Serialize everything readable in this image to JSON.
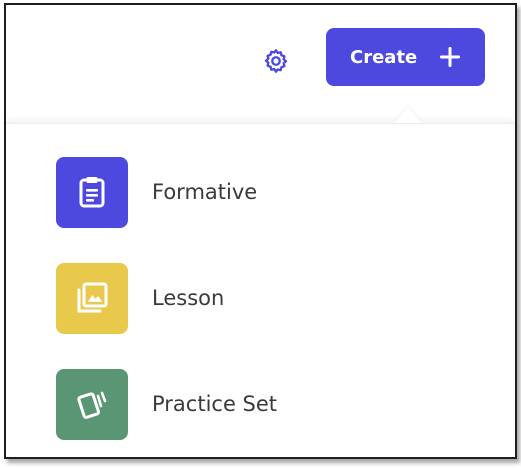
{
  "header": {
    "settings_icon": "gear-icon",
    "create_button": {
      "label": "Create",
      "icon": "plus-icon"
    }
  },
  "menu": {
    "items": [
      {
        "label": "Formative",
        "icon": "clipboard-icon",
        "color": "#4d49de"
      },
      {
        "label": "Lesson",
        "icon": "image-stack-icon",
        "color": "#e9c94b"
      },
      {
        "label": "Practice Set",
        "icon": "cards-icon",
        "color": "#5a9673"
      }
    ]
  },
  "colors": {
    "accent": "#4d49de",
    "text": "#3a3a3a"
  }
}
